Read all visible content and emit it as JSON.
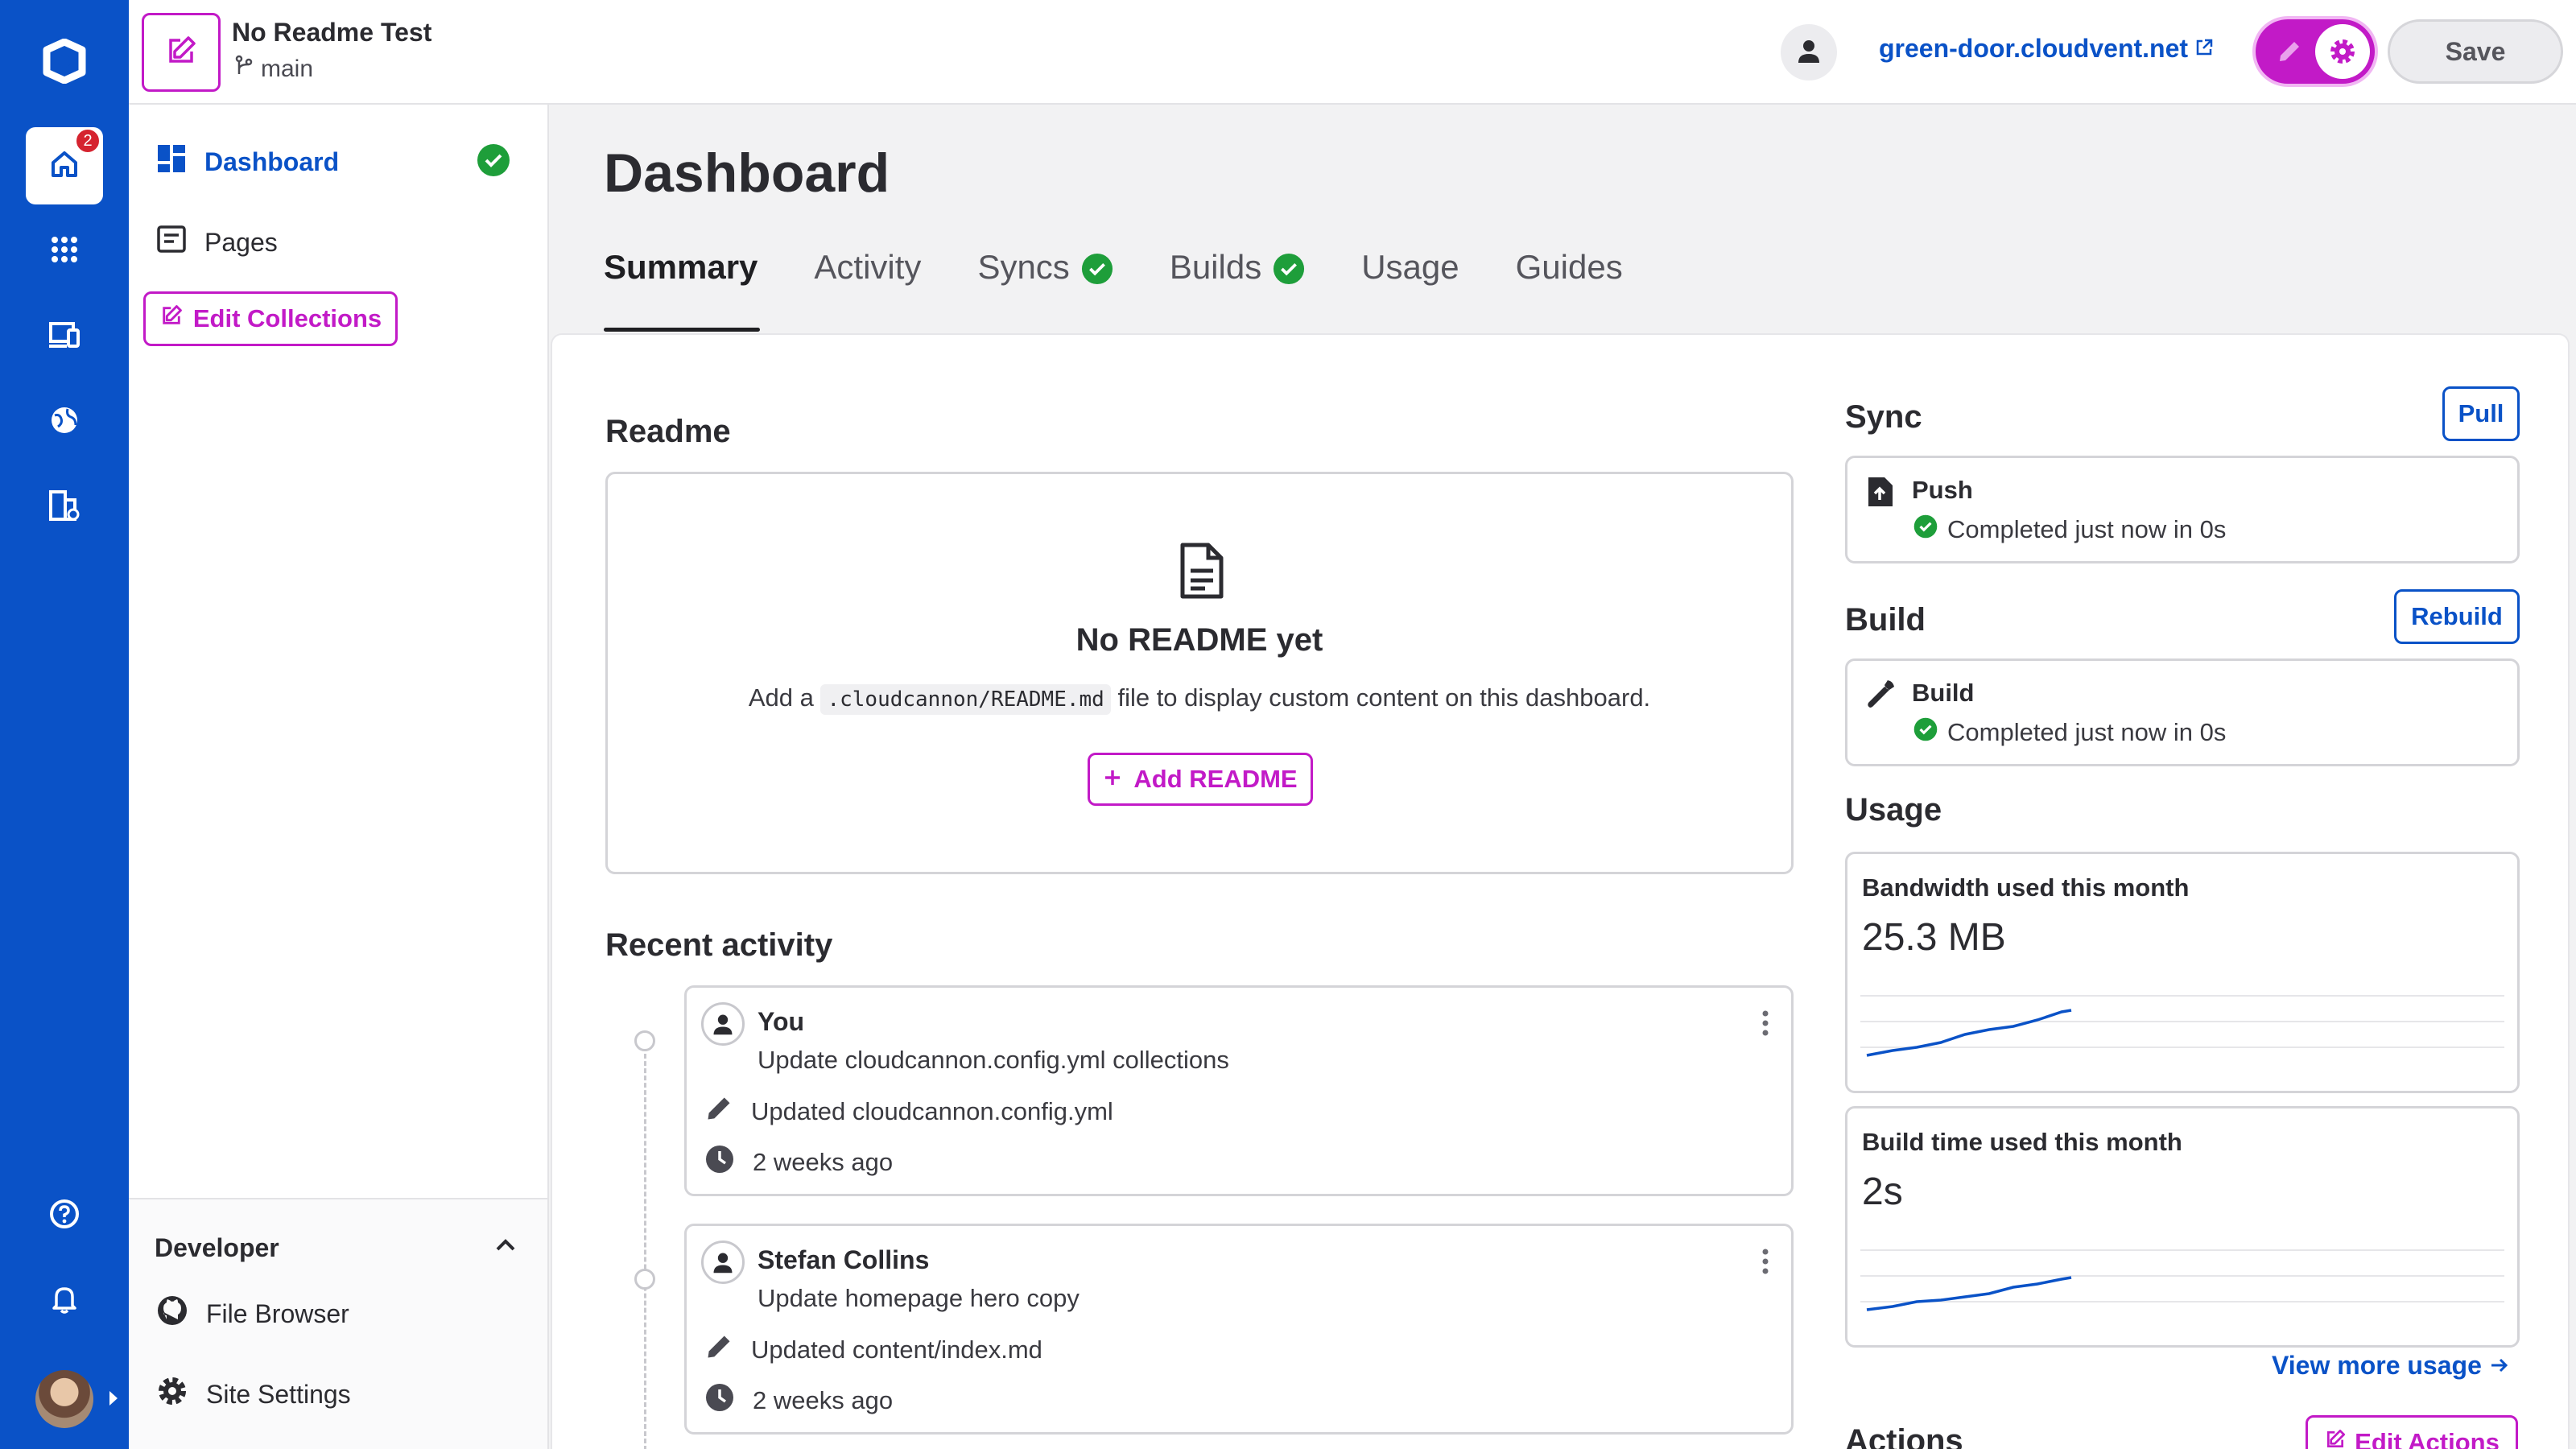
{
  "rail": {
    "home_badge": "2",
    "icons": [
      "cloudcannon-logo-icon",
      "home-icon",
      "apps-grid-icon",
      "devices-icon",
      "globe-icon",
      "organization-settings-icon",
      "help-icon",
      "bell-icon"
    ]
  },
  "topbar": {
    "site_name": "No Readme Test",
    "branch": "main",
    "domain": "green-door.cloudvent.net",
    "save_label": "Save"
  },
  "sidebar": {
    "items": [
      {
        "label": "Dashboard",
        "icon": "dashboard-icon",
        "active": true
      },
      {
        "label": "Pages",
        "icon": "pages-icon"
      }
    ],
    "edit_collections": "Edit Collections",
    "developer": {
      "title": "Developer",
      "items": [
        {
          "label": "File Browser",
          "icon": "github-icon"
        },
        {
          "label": "Site Settings",
          "icon": "gear-icon"
        }
      ]
    }
  },
  "main": {
    "title": "Dashboard",
    "tabs": [
      {
        "label": "Summary",
        "active": true
      },
      {
        "label": "Activity"
      },
      {
        "label": "Syncs",
        "check": true
      },
      {
        "label": "Builds",
        "check": true
      },
      {
        "label": "Usage"
      },
      {
        "label": "Guides"
      }
    ],
    "readme": {
      "heading": "Readme",
      "title": "No README yet",
      "desc_before": "Add a",
      "desc_code": ".cloudcannon/README.md",
      "desc_after": "file to display custom content on this dashboard.",
      "add_button": "Add README"
    },
    "recent_activity": {
      "heading": "Recent activity",
      "items": [
        {
          "name": "You",
          "message": "Update cloudcannon.config.yml collections",
          "file": "Updated cloudcannon.config.yml",
          "time": "2 weeks ago"
        },
        {
          "name": "Stefan Collins",
          "message": "Update homepage hero copy",
          "file": "Updated content/index.md",
          "time": "2 weeks ago"
        }
      ]
    },
    "sync": {
      "heading": "Sync",
      "button": "Pull",
      "card_title": "Push",
      "status": "Completed just now in 0s"
    },
    "build": {
      "heading": "Build",
      "button": "Rebuild",
      "card_title": "Build",
      "status": "Completed just now in 0s"
    },
    "usage": {
      "heading": "Usage",
      "bandwidth_label": "Bandwidth used this month",
      "bandwidth_value": "25.3 MB",
      "build_time_label": "Build time used this month",
      "build_time_value": "2s",
      "view_more": "View more usage"
    },
    "actions": {
      "heading": "Actions",
      "edit_button": "Edit Actions"
    }
  },
  "colors": {
    "rail": "#0a52c7",
    "brand_link": "#0a52c7",
    "accent_magenta": "#c21ac7",
    "success": "#1e9e3a"
  }
}
